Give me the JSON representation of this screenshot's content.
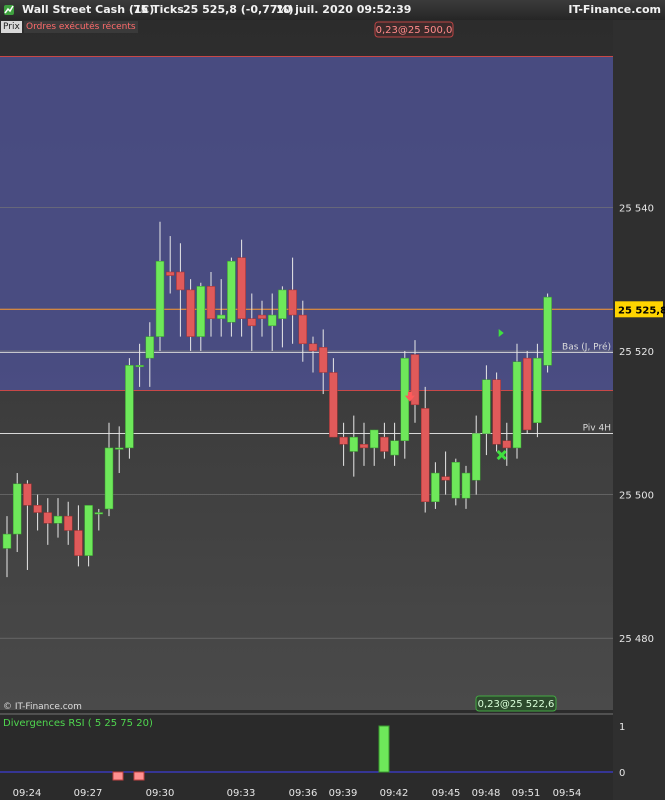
{
  "window": {
    "title": "Wall Street Cash (1€)",
    "ticks": "75 Ticks",
    "price_change": "25 525,8 (-0,77%)",
    "datetime": "10 juil. 2020 09:52:39",
    "brand": "IT-Finance.com"
  },
  "tabs": {
    "prix": "Prix",
    "orders": "Ordres exécutés récents"
  },
  "watermark": "© IT-Finance.com",
  "colors": {
    "up": "#6ee85a",
    "down": "#e05a5a",
    "band": "#4b4f8a",
    "bg_top": "#2c2c2c",
    "bg_bottom": "#4a4a4a",
    "current": "#ffd400"
  },
  "chart_data": {
    "type": "candlestick",
    "ylim": [
      25470,
      25564
    ],
    "y_ticks": [
      {
        "value": 25540,
        "label": "25 540"
      },
      {
        "value": 25520,
        "label": "25 520"
      },
      {
        "value": 25500,
        "label": "25 500"
      },
      {
        "value": 25480,
        "label": "25 480"
      }
    ],
    "x_labels": [
      {
        "index": 2,
        "label": "09:24"
      },
      {
        "index": 8.5,
        "label": "09:27"
      },
      {
        "index": 15.5,
        "label": "09:30"
      },
      {
        "index": 23.5,
        "label": "09:33"
      },
      {
        "index": 29.5,
        "label": "09:36"
      },
      {
        "index": 34,
        "label": "09:39"
      },
      {
        "index": 39,
        "label": "09:42"
      },
      {
        "index": 44,
        "label": "09:45"
      },
      {
        "index": 48,
        "label": "09:48"
      },
      {
        "index": 52,
        "label": "09:51"
      },
      {
        "index": 56.5,
        "label": "09:54"
      }
    ],
    "candles": [
      {
        "o": 25492.5,
        "h": 25497,
        "l": 25488.5,
        "c": 25494.5
      },
      {
        "o": 25494.5,
        "h": 25503,
        "l": 25492,
        "c": 25501.5
      },
      {
        "o": 25501.5,
        "h": 25502,
        "l": 25489.5,
        "c": 25498.5
      },
      {
        "o": 25498.5,
        "h": 25500,
        "l": 25495,
        "c": 25497.5
      },
      {
        "o": 25497.5,
        "h": 25499.5,
        "l": 25493,
        "c": 25496
      },
      {
        "o": 25496,
        "h": 25499.5,
        "l": 25494,
        "c": 25497
      },
      {
        "o": 25497,
        "h": 25499,
        "l": 25493,
        "c": 25495
      },
      {
        "o": 25495,
        "h": 25498.5,
        "l": 25490,
        "c": 25491.5
      },
      {
        "o": 25491.5,
        "h": 25495,
        "l": 25490,
        "c": 25498.5
      },
      {
        "o": 25497.5,
        "h": 25498,
        "l": 25495,
        "c": 25497.5
      },
      {
        "o": 25498,
        "h": 25510,
        "l": 25497,
        "c": 25506.5
      },
      {
        "o": 25506.5,
        "h": 25509.5,
        "l": 25503,
        "c": 25506.5
      },
      {
        "o": 25506.5,
        "h": 25519,
        "l": 25505,
        "c": 25518
      },
      {
        "o": 25518,
        "h": 25521,
        "l": 25515,
        "c": 25518
      },
      {
        "o": 25519,
        "h": 25524,
        "l": 25515,
        "c": 25522
      },
      {
        "o": 25522,
        "h": 25538,
        "l": 25520,
        "c": 25532.5
      },
      {
        "o": 25531,
        "h": 25536,
        "l": 25528,
        "c": 25530.5
      },
      {
        "o": 25531,
        "h": 25535,
        "l": 25522,
        "c": 25528.5
      },
      {
        "o": 25528.5,
        "h": 25530,
        "l": 25520,
        "c": 25522
      },
      {
        "o": 25522,
        "h": 25529.5,
        "l": 25520,
        "c": 25529
      },
      {
        "o": 25529,
        "h": 25531,
        "l": 25522,
        "c": 25524.5
      },
      {
        "o": 25524.5,
        "h": 25530,
        "l": 25522,
        "c": 25525
      },
      {
        "o": 25524,
        "h": 25533,
        "l": 25522,
        "c": 25532.5
      },
      {
        "o": 25533,
        "h": 25535.5,
        "l": 25522,
        "c": 25524.5
      },
      {
        "o": 25524.5,
        "h": 25528,
        "l": 25520,
        "c": 25523.5
      },
      {
        "o": 25525,
        "h": 25527,
        "l": 25522,
        "c": 25524.5
      },
      {
        "o": 25523.5,
        "h": 25528,
        "l": 25520,
        "c": 25525
      },
      {
        "o": 25524.5,
        "h": 25529,
        "l": 25520.5,
        "c": 25528.5
      },
      {
        "o": 25528.5,
        "h": 25533,
        "l": 25521,
        "c": 25525
      },
      {
        "o": 25525,
        "h": 25527,
        "l": 25518.5,
        "c": 25521
      },
      {
        "o": 25521,
        "h": 25522,
        "l": 25517,
        "c": 25520
      },
      {
        "o": 25520.5,
        "h": 25523,
        "l": 25514,
        "c": 25517
      },
      {
        "o": 25517,
        "h": 25519,
        "l": 25508,
        "c": 25508
      },
      {
        "o": 25508,
        "h": 25510,
        "l": 25504,
        "c": 25507
      },
      {
        "o": 25506,
        "h": 25511,
        "l": 25502.5,
        "c": 25508
      },
      {
        "o": 25507,
        "h": 25510,
        "l": 25504,
        "c": 25506.5
      },
      {
        "o": 25506.5,
        "h": 25509,
        "l": 25504,
        "c": 25509
      },
      {
        "o": 25508,
        "h": 25510,
        "l": 25505,
        "c": 25506
      },
      {
        "o": 25505.5,
        "h": 25510,
        "l": 25504,
        "c": 25507.5
      },
      {
        "o": 25507.5,
        "h": 25520,
        "l": 25505,
        "c": 25519
      },
      {
        "o": 25519.5,
        "h": 25521.5,
        "l": 25510,
        "c": 25512.5
      },
      {
        "o": 25512,
        "h": 25515,
        "l": 25497.5,
        "c": 25499
      },
      {
        "o": 25499,
        "h": 25504.5,
        "l": 25498,
        "c": 25503
      },
      {
        "o": 25502.5,
        "h": 25506,
        "l": 25500,
        "c": 25502
      },
      {
        "o": 25499.5,
        "h": 25505,
        "l": 25498.5,
        "c": 25504.5
      },
      {
        "o": 25499.5,
        "h": 25504,
        "l": 25498,
        "c": 25503
      },
      {
        "o": 25502,
        "h": 25511,
        "l": 25500,
        "c": 25508.5
      },
      {
        "o": 25508.5,
        "h": 25518,
        "l": 25505.5,
        "c": 25516
      },
      {
        "o": 25516,
        "h": 25517,
        "l": 25506,
        "c": 25507
      },
      {
        "o": 25507.5,
        "h": 25510,
        "l": 25504,
        "c": 25506.5
      },
      {
        "o": 25506.5,
        "h": 25521,
        "l": 25505,
        "c": 25518.5
      },
      {
        "o": 25519,
        "h": 25520,
        "l": 25508.5,
        "c": 25509
      },
      {
        "o": 25510,
        "h": 25521,
        "l": 25508,
        "c": 25519
      },
      {
        "o": 25518,
        "h": 25528,
        "l": 25517,
        "c": 25527.5
      }
    ],
    "band": {
      "from": 25514.5,
      "to": 25561,
      "color": "#4b4f8a"
    },
    "lines": [
      {
        "value": 25525.8,
        "color": "#ff9a2e",
        "label": "25 525,8",
        "kind": "current"
      },
      {
        "value": 25519.8,
        "color": "#d8d8d8",
        "label": "Bas (J, Pré)",
        "kind": "level"
      },
      {
        "value": 25508.5,
        "color": "#d8d8d8",
        "label": "Piv 4H",
        "kind": "level"
      }
    ],
    "markers": [
      {
        "index": 39.5,
        "value": 25513.5,
        "type": "sell-arrow"
      },
      {
        "index": 48.4,
        "value": 25522.5,
        "type": "buy-triangle"
      },
      {
        "index": 48.5,
        "value": 25505.5,
        "type": "close-cross"
      }
    ],
    "top_label": "0,23@25 500,0",
    "bottom_label": "0,23@25 522,6",
    "indicator": {
      "title": "Divergences RSI ( 5 25 75 20)",
      "ylim": [
        0,
        1
      ],
      "ticks": [
        {
          "value": 1,
          "label": "1"
        },
        {
          "value": 0,
          "label": "0"
        }
      ],
      "bars": [
        {
          "index": 9.5,
          "value": -1
        },
        {
          "index": 11.2,
          "value": -1
        },
        {
          "index": 31.5,
          "value": 1
        }
      ]
    }
  }
}
